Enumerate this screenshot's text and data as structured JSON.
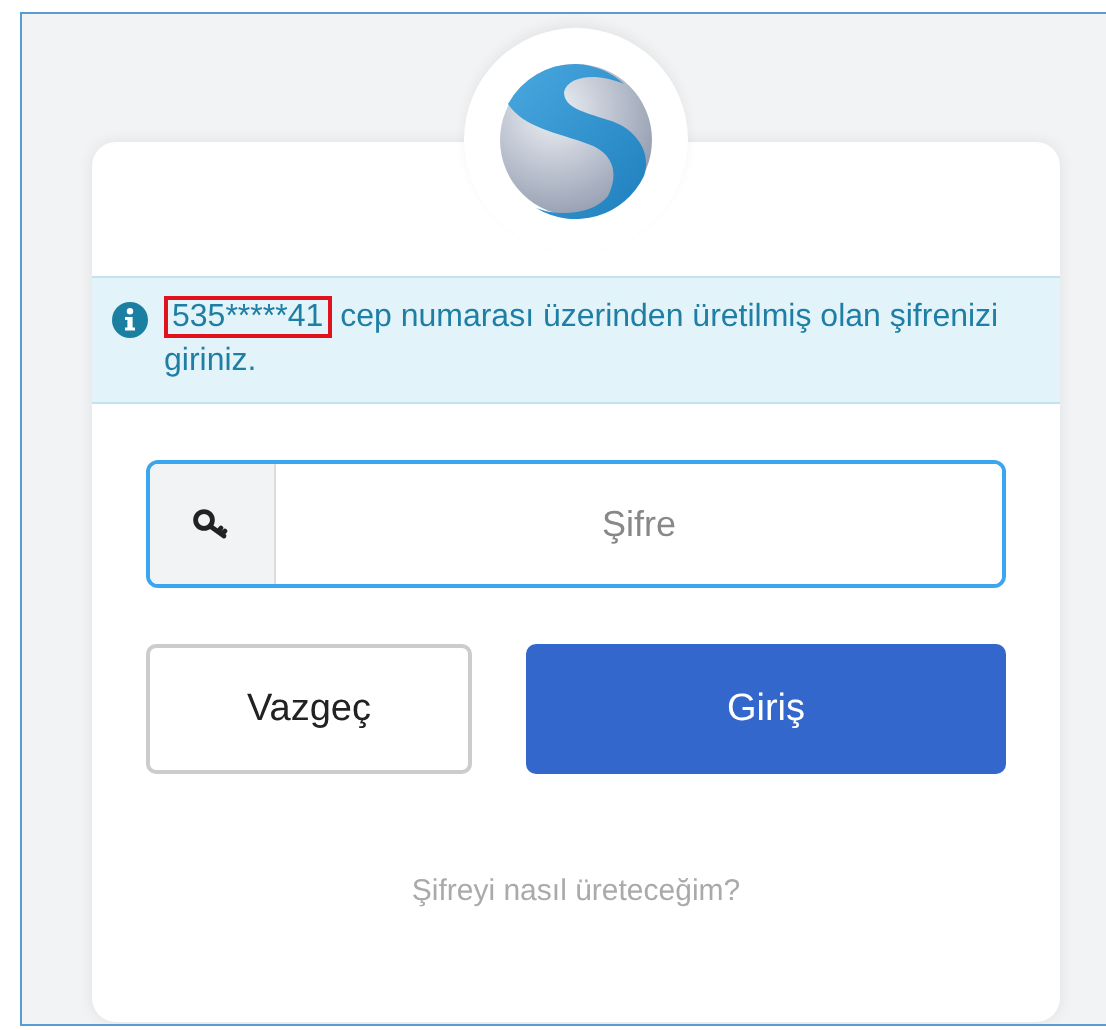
{
  "info": {
    "phone": "535*****41",
    "phone_highlighted": true,
    "message": "cep numarası üzerinden üretilmiş olan şifrenizi giriniz."
  },
  "password_field": {
    "placeholder": "Şifre",
    "focused": true
  },
  "buttons": [
    {
      "label": "Vazgeç",
      "kind": "secondary"
    },
    {
      "label": "Giriş",
      "kind": "primary"
    }
  ],
  "help_link": "Şifreyi nasıl üreteceğim?"
}
